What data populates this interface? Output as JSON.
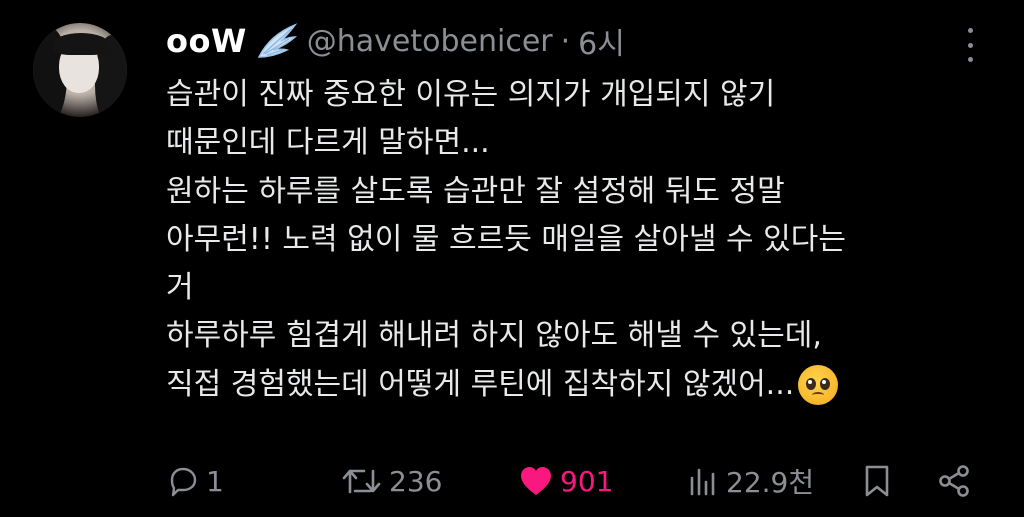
{
  "tweet": {
    "author_name": "ooW",
    "handle": "@havetobenicer",
    "separator": "·",
    "time": "6시",
    "lines": [
      "습관이 진짜 중요한 이유는 의지가 개입되지 않기",
      "때문인데 다르게 말하면...",
      "원하는 하루를 살도록 습관만 잘 설정해 둬도 정말",
      "아무런!! 노력 없이 물 흐르듯 매일을 살아낼 수 있다는",
      "거",
      "하루하루 힘겹게 해내려 하지 않아도 해낼 수 있는데,",
      "직접 경험했는데 어떻게 루틴에 집착하지 않겠어..."
    ],
    "emoji": "pleading-face-emoji",
    "verified_badge_icon": "angel-wing-icon"
  },
  "actions": {
    "reply_count": "1",
    "retweet_count": "236",
    "like_count": "901",
    "views_count": "22.9천"
  },
  "colors": {
    "background": "#000000",
    "text": "#e7e9ea",
    "muted": "#8b8f94",
    "like": "#f91880"
  }
}
